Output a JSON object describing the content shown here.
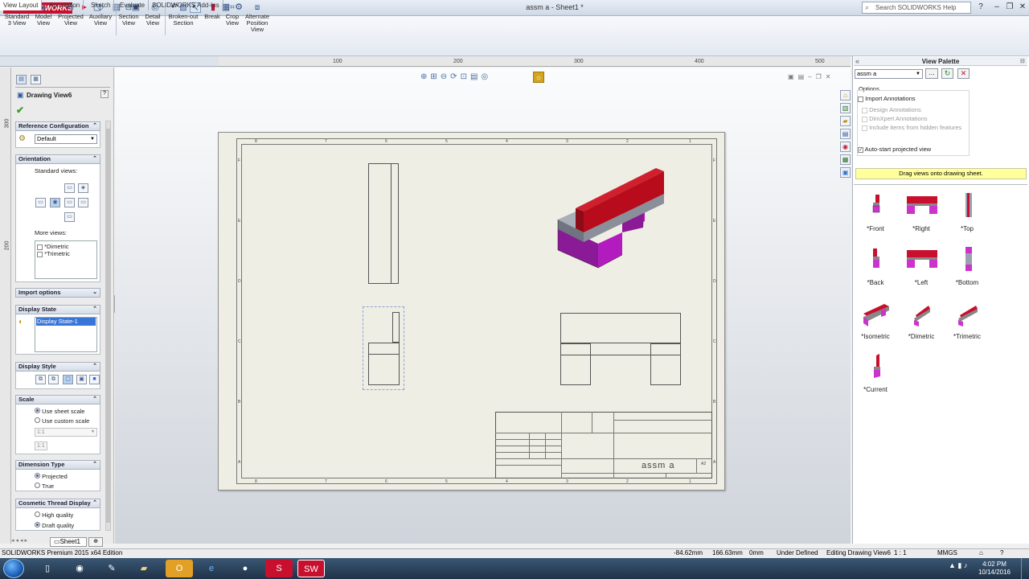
{
  "app": {
    "logo": "3DS SOLIDWORKS",
    "doc_title": "assm a - Sheet1 *",
    "search_placeholder": "Search SOLIDWORKS Help"
  },
  "command_manager": [
    {
      "icon": "standard-3-view-icon",
      "label": "Standard 3 View"
    },
    {
      "icon": "model-view-icon",
      "label": "Model View"
    },
    {
      "icon": "projected-view-icon",
      "label": "Projected View"
    },
    {
      "icon": "auxiliary-view-icon",
      "label": "Auxiliary View"
    },
    {
      "icon": "section-view-icon",
      "label": "Section View"
    },
    {
      "icon": "detail-view-icon",
      "label": "Detail View"
    },
    {
      "icon": "broken-out-section-icon",
      "label": "Broken-out Section"
    },
    {
      "icon": "break-icon",
      "label": "Break"
    },
    {
      "icon": "crop-view-icon",
      "label": "Crop View"
    },
    {
      "icon": "alternate-position-view-icon",
      "label": "Alternate Position View"
    }
  ],
  "tabs": [
    "View Layout",
    "Annotation",
    "Sketch",
    "Evaluate",
    "SOLIDWORKS Add-Ins"
  ],
  "ruler_top": [
    "100",
    "200",
    "300",
    "400",
    "500"
  ],
  "ruler_left": [
    "300",
    "200"
  ],
  "property_manager": {
    "title": "Drawing View6",
    "reference_configuration": {
      "header": "Reference Configuration",
      "value": "Default"
    },
    "orientation": {
      "header": "Orientation",
      "standard_views_label": "Standard views:",
      "more_views_label": "More views:",
      "more_views": [
        "*Dimetric",
        "*Trimetric"
      ]
    },
    "import_options": {
      "header": "Import options"
    },
    "display_state": {
      "header": "Display State",
      "item": "Display State-1"
    },
    "display_style": {
      "header": "Display Style"
    },
    "scale": {
      "header": "Scale",
      "options": [
        "Use sheet scale",
        "Use custom scale"
      ],
      "selected": "Use sheet scale",
      "custom_value": "1:1",
      "custom_value2": "1:1"
    },
    "dimension_type": {
      "header": "Dimension Type",
      "options": [
        "Projected",
        "True"
      ],
      "selected": "Projected"
    },
    "cosmetic_thread": {
      "header": "Cosmetic Thread Display",
      "options": [
        "High quality",
        "Draft quality"
      ],
      "selected": "Draft quality"
    }
  },
  "sheet": {
    "zones_top": [
      "8",
      "7",
      "6",
      "5",
      "4",
      "3",
      "2",
      "1"
    ],
    "zones_side": [
      "F",
      "E",
      "D",
      "C",
      "B",
      "A"
    ],
    "title_block_name": "assm a",
    "title_block_size": "A2"
  },
  "view_palette": {
    "title": "View Palette",
    "document": "assm a",
    "options_label": "Options",
    "import_annotations": {
      "label": "Import Annotations",
      "checked": false
    },
    "sub_options": [
      "Design Annotations",
      "DimXpert Annotations",
      "Include items from hidden features"
    ],
    "auto_start": {
      "label": "Auto-start projected view",
      "checked": true
    },
    "drag_hint": "Drag views onto drawing sheet.",
    "views": [
      "*Front",
      "*Right",
      "*Top",
      "*Back",
      "*Left",
      "*Bottom",
      "*Isometric",
      "*Dimetric",
      "*Trimetric",
      "*Current"
    ]
  },
  "sheet_tabs": [
    "Sheet1"
  ],
  "status": {
    "edition": "SOLIDWORKS Premium 2015 x64 Edition",
    "x": "-84.62mm",
    "y": "166.63mm",
    "z": "0mm",
    "state": "Under Defined",
    "editing": "Editing Drawing View6",
    "scale": "1 : 1",
    "units": "MMGS"
  },
  "taskbar": {
    "time": "4:02 PM",
    "date": "10/14/2016"
  },
  "colors": {
    "accent_red": "#c8102e",
    "part_red": "#b80c1c",
    "part_magenta": "#b21cbf",
    "part_gray": "#8a8f9a",
    "drag_hint_bg": "#ffff9c"
  }
}
